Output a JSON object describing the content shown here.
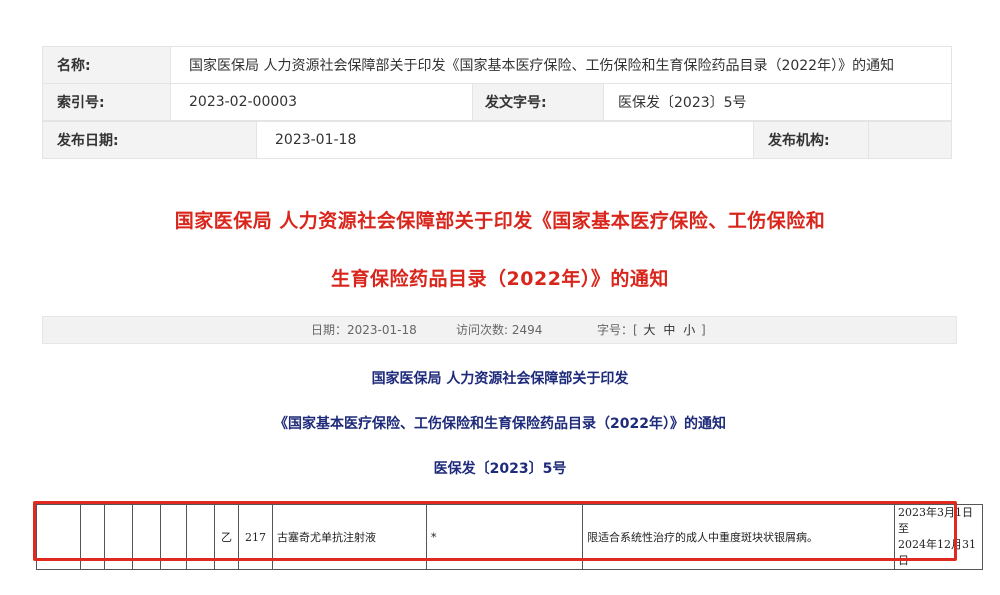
{
  "meta": {
    "name_label": "名称:",
    "name_value": "国家医保局 人力资源社会保障部关于印发《国家基本医疗保险、工伤保险和生育保险药品目录（2022年）》的通知",
    "index_label": "索引号:",
    "index_value": "2023-02-00003",
    "docno_label": "发文字号:",
    "docno_value": "医保发〔2023〕5号",
    "date_label": "发布日期:",
    "date_value": "2023-01-18",
    "org_label": "发布机构:",
    "org_value": ""
  },
  "title": {
    "line1": "国家医保局 人力资源社会保障部关于印发《国家基本医疗保险、工伤保险和",
    "line2": "生育保险药品目录（2022年）》的通知"
  },
  "info_bar": {
    "date": "日期：2023-01-18",
    "visits": "访问次数:  2494",
    "font_label": "字号：[",
    "size_large": "大",
    "size_medium": "中",
    "size_small": "小",
    "font_close": "]"
  },
  "doc_header": {
    "line1": "国家医保局  人力资源社会保障部关于印发",
    "line2": "《国家基本医疗保险、工伤保险和生育保险药品目录（2022年）》的通知",
    "line3": "医保发〔2023〕5号"
  },
  "drug_row": {
    "category": "乙",
    "number": "217",
    "drug_name": "古塞奇尤单抗注射液",
    "mark": "*",
    "remark": "限适合系统性治疗的成人中重度斑块状银屑病。",
    "period_line1": "2023年3月1日至",
    "period_line2": "2024年12月31日"
  },
  "colors": {
    "title_red": "#d9261c",
    "doc_navy": "#1e2a7a",
    "highlight_red": "#e0291f"
  }
}
